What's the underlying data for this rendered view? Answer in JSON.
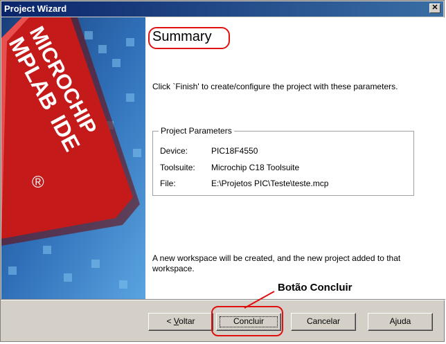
{
  "window": {
    "title": "Project Wizard"
  },
  "banner": {
    "logo_text_1": "MICROCHIP",
    "logo_text_2": "MPLAB",
    "logo_text_3": "IDE",
    "registered": "®"
  },
  "page": {
    "title": "Summary",
    "intro": "Click `Finish' to create/configure the project with these parameters.",
    "group_title": "Project Parameters",
    "params": [
      {
        "label": "Device:",
        "value": "PIC18F4550"
      },
      {
        "label": "Toolsuite:",
        "value": "Microchip C18 Toolsuite"
      },
      {
        "label": "File:",
        "value": "E:\\Projetos PIC\\Teste\\teste.mcp"
      }
    ],
    "footer": "A new workspace will be created, and the new project added to that workspace."
  },
  "annotation": {
    "label": "Botão Concluir",
    "color": "#e01010"
  },
  "buttons": {
    "back_prefix": "< ",
    "back_mnemonic": "V",
    "back_rest": "oltar",
    "finish": "Concluir",
    "cancel": "Cancelar",
    "help": "Ajuda"
  }
}
